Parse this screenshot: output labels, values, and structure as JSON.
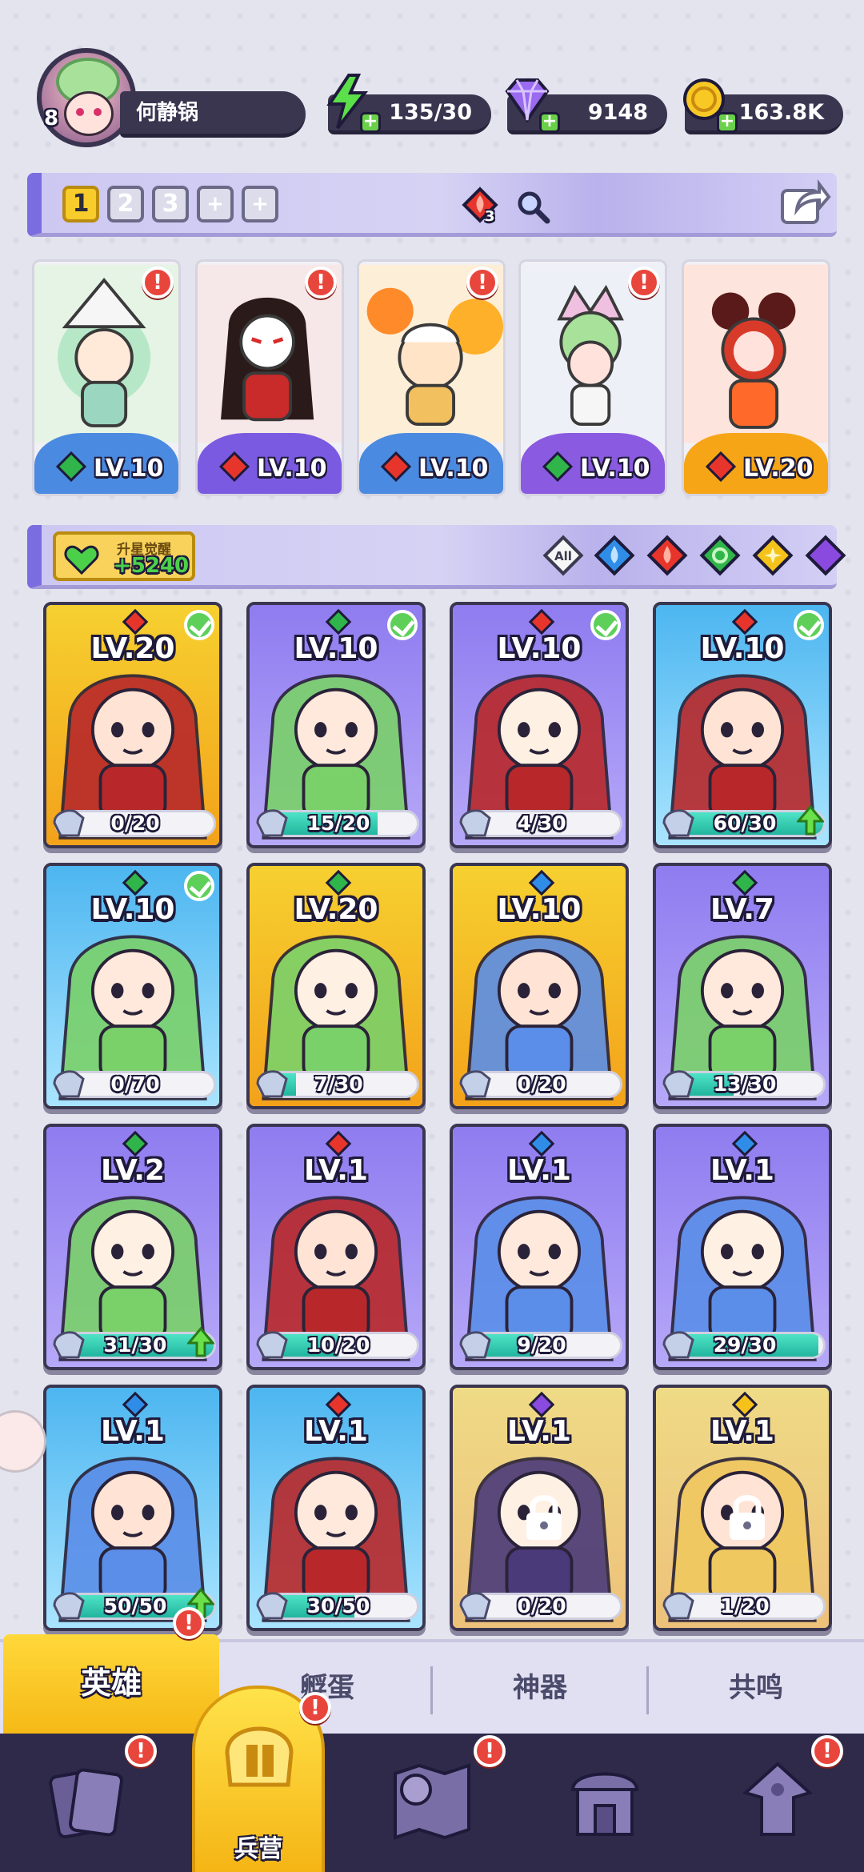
{
  "player": {
    "level": "8",
    "name": "何静锅"
  },
  "resources": {
    "energy": "135/30",
    "gems": "9148",
    "gold": "163.8K"
  },
  "team_bar": {
    "slots": [
      "1",
      "2",
      "3",
      "+",
      "+"
    ],
    "active_slot": "1",
    "red_element_count": "3"
  },
  "team": [
    {
      "level": "LV.10",
      "element": "nature",
      "footer_color": "#4a8ae0",
      "alert": "!"
    },
    {
      "level": "LV.10",
      "element": "fire",
      "footer_color": "#7a5ae0",
      "alert": "!"
    },
    {
      "level": "LV.10",
      "element": "fire",
      "footer_color": "#4a8ae0",
      "alert": "!"
    },
    {
      "level": "LV.10",
      "element": "nature",
      "footer_color": "#8a5ae0",
      "alert": "!"
    },
    {
      "level": "LV.20",
      "element": "fire",
      "footer_color": "#f5a516",
      "alert": ""
    }
  ],
  "filter_bar": {
    "awaken_title": "升星觉醒",
    "awaken_value": "+5240",
    "filters": [
      "All",
      "water",
      "fire",
      "nature",
      "light",
      "dark"
    ]
  },
  "heroes": [
    {
      "level": "LV.20",
      "progress": "0/20",
      "fill": 0.0,
      "element": "fire",
      "checked": true,
      "rarity": "gold"
    },
    {
      "level": "LV.10",
      "progress": "15/20",
      "fill": 0.75,
      "element": "nature",
      "checked": true,
      "rarity": "purple"
    },
    {
      "level": "LV.10",
      "progress": "4/30",
      "fill": 0.13,
      "element": "fire",
      "checked": true,
      "rarity": "purple"
    },
    {
      "level": "LV.10",
      "progress": "60/30",
      "fill": 1.0,
      "element": "fire",
      "checked": true,
      "rarity": "blue",
      "upgrade": true
    },
    {
      "level": "LV.10",
      "progress": "0/70",
      "fill": 0.0,
      "element": "nature",
      "checked": true,
      "rarity": "blue"
    },
    {
      "level": "LV.20",
      "progress": "7/30",
      "fill": 0.23,
      "element": "nature",
      "checked": false,
      "rarity": "gold"
    },
    {
      "level": "LV.10",
      "progress": "0/20",
      "fill": 0.0,
      "element": "water",
      "checked": false,
      "rarity": "gold"
    },
    {
      "level": "LV.7",
      "progress": "13/30",
      "fill": 0.43,
      "element": "nature",
      "checked": false,
      "rarity": "purple"
    },
    {
      "level": "LV.2",
      "progress": "31/30",
      "fill": 1.0,
      "element": "nature",
      "checked": false,
      "rarity": "purple",
      "upgrade": true
    },
    {
      "level": "LV.1",
      "progress": "10/20",
      "fill": 0.5,
      "element": "fire",
      "checked": false,
      "rarity": "purple"
    },
    {
      "level": "LV.1",
      "progress": "9/20",
      "fill": 0.45,
      "element": "water",
      "checked": false,
      "rarity": "purple"
    },
    {
      "level": "LV.1",
      "progress": "29/30",
      "fill": 0.97,
      "element": "water",
      "checked": false,
      "rarity": "purple"
    },
    {
      "level": "LV.1",
      "progress": "50/50",
      "fill": 1.0,
      "element": "water",
      "checked": false,
      "rarity": "blue",
      "upgrade": true
    },
    {
      "level": "LV.1",
      "progress": "30/50",
      "fill": 0.6,
      "element": "fire",
      "checked": false,
      "rarity": "blue"
    },
    {
      "level": "LV.1",
      "progress": "0/20",
      "fill": 0.0,
      "element": "dark",
      "checked": false,
      "rarity": "gold",
      "locked": true
    },
    {
      "level": "LV.1",
      "progress": "1/20",
      "fill": 0.05,
      "element": "light",
      "checked": false,
      "rarity": "gold",
      "locked": true
    }
  ],
  "tabs": {
    "hero": "英雄",
    "egg": "孵蛋",
    "artifact": "神器",
    "resonance": "共鸣",
    "hero_alert": "!"
  },
  "bottom_nav": {
    "barracks_label": "兵营",
    "alert": "!"
  },
  "colors": {
    "fire": "#e8352c",
    "nature": "#2fb54a",
    "water": "#2f8de8",
    "light": "#f5c21a",
    "dark": "#8a4ae0"
  }
}
